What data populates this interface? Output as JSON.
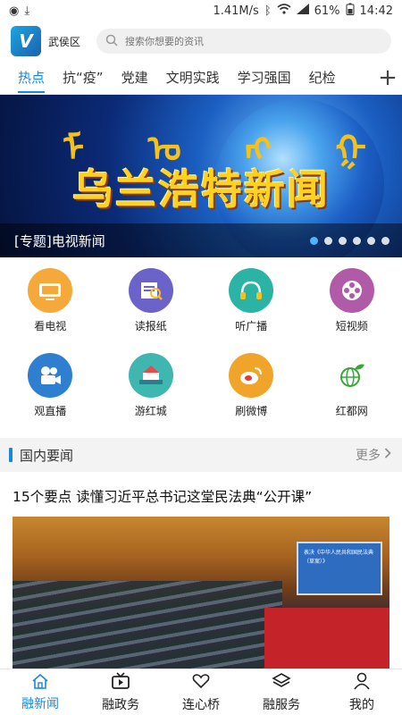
{
  "status_bar": {
    "network_speed": "1.41M/s",
    "battery": "61%",
    "time": "14:42"
  },
  "header": {
    "location": "武侯区",
    "search_placeholder": "搜索你想要的资讯"
  },
  "tabs": [
    {
      "label": "热点",
      "active": true
    },
    {
      "label": "抗“疫”",
      "active": false
    },
    {
      "label": "党建",
      "active": false
    },
    {
      "label": "文明实践",
      "active": false
    },
    {
      "label": "学习强国",
      "active": false
    },
    {
      "label": "纪检",
      "active": false
    }
  ],
  "tab_add_label": "+",
  "banner": {
    "headline": "乌兰浩特新闻",
    "caption": "[专题]电视新闻",
    "slide_count": 6,
    "active_slide": 1
  },
  "features": [
    {
      "label": "看电视",
      "icon": "tv-icon",
      "color": "#f4a93a"
    },
    {
      "label": "读报纸",
      "icon": "newspaper-icon",
      "color": "#6b63c9"
    },
    {
      "label": "听广播",
      "icon": "headphones-icon",
      "color": "#2bb3a6"
    },
    {
      "label": "短视频",
      "icon": "film-reel-icon",
      "color": "#b05aa8"
    },
    {
      "label": "观直播",
      "icon": "video-camera-icon",
      "color": "#2f7fd0"
    },
    {
      "label": "游红城",
      "icon": "landmark-icon",
      "color": "#3fb6b0"
    },
    {
      "label": "刷微博",
      "icon": "weibo-icon",
      "color": "#f0a52a"
    },
    {
      "label": "红都网",
      "icon": "globe-leaf-icon",
      "color": "#3aa63a"
    }
  ],
  "section": {
    "title": "国内要闻",
    "more": "更多"
  },
  "article": {
    "title": "15个要点 读懂习近平总书记这堂民法典“公开课”",
    "image_screen_text": "表决《中华人民共和国民法典（草案）》"
  },
  "bottom_nav": [
    {
      "label": "融新闻",
      "icon": "home-icon",
      "active": true
    },
    {
      "label": "融政务",
      "icon": "tv-play-icon",
      "active": false
    },
    {
      "label": "连心桥",
      "icon": "heart-hands-icon",
      "active": false
    },
    {
      "label": "融服务",
      "icon": "layers-icon",
      "active": false
    },
    {
      "label": "我的",
      "icon": "user-icon",
      "active": false
    }
  ],
  "colors": {
    "accent": "#1a88d8"
  }
}
